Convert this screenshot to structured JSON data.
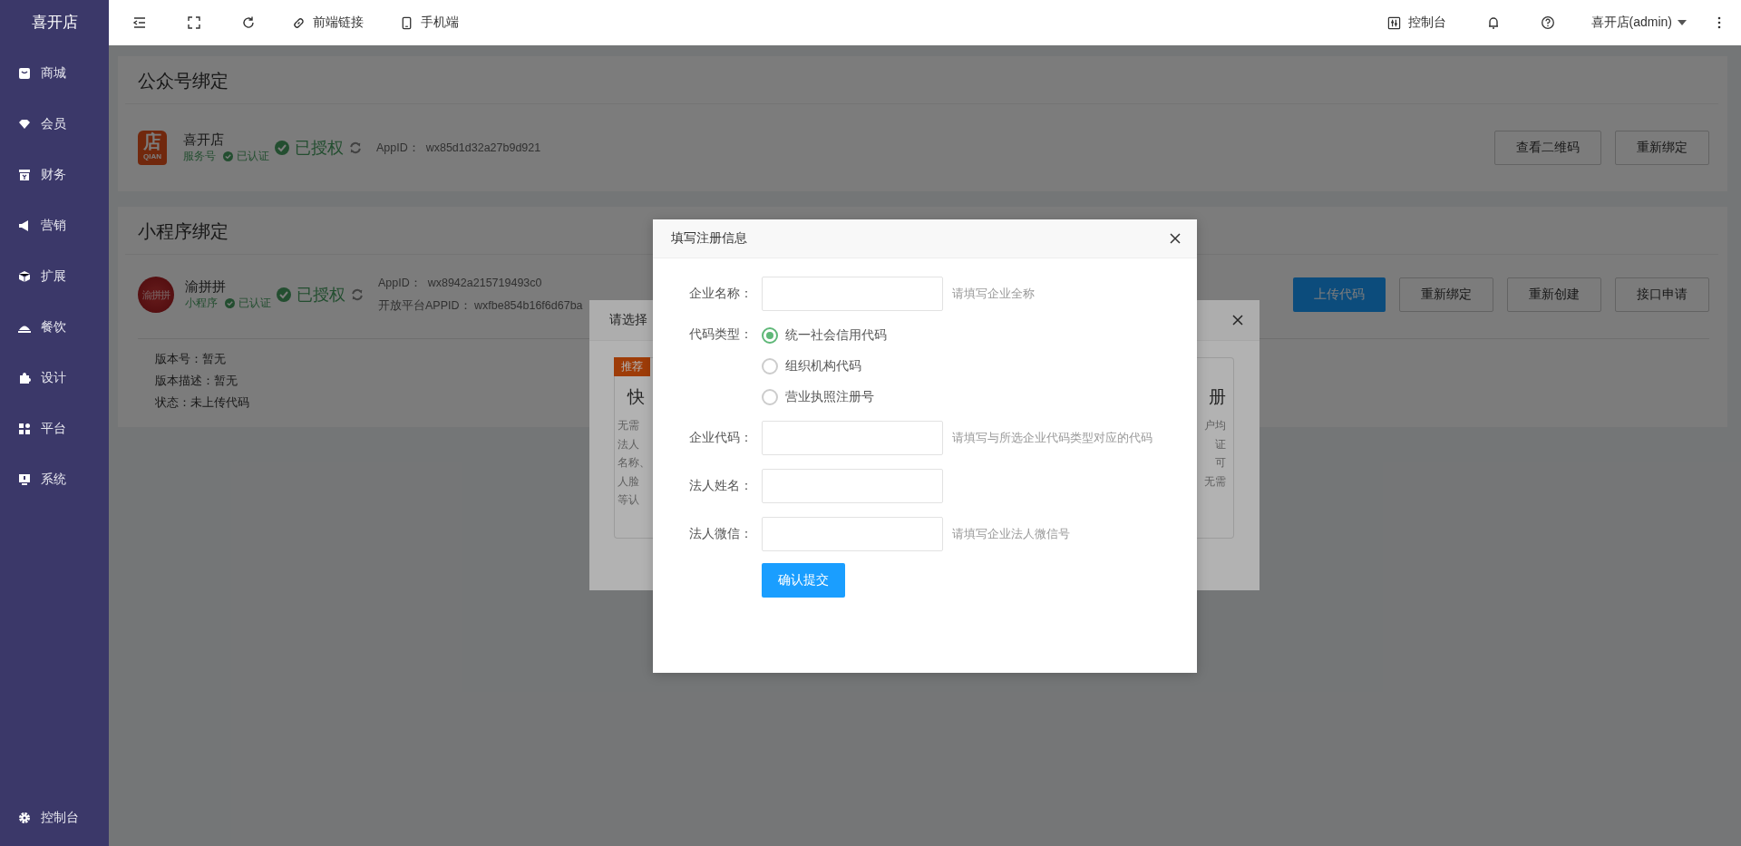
{
  "sidebar": {
    "logo": "喜开店",
    "items": [
      {
        "label": "商城"
      },
      {
        "label": "会员"
      },
      {
        "label": "财务"
      },
      {
        "label": "营销"
      },
      {
        "label": "扩展"
      },
      {
        "label": "餐饮"
      },
      {
        "label": "设计"
      },
      {
        "label": "平台"
      },
      {
        "label": "系统"
      }
    ],
    "footer": {
      "label": "控制台"
    }
  },
  "topbar": {
    "links": [
      "前端链接",
      "手机端"
    ],
    "console": "控制台",
    "user": "喜开店(admin)"
  },
  "official_account": {
    "title": "公众号绑定",
    "logo_text": "店",
    "logo_subtext": "QIAN",
    "name": "喜开店",
    "type": "服务号",
    "verified": "已认证",
    "auth": "已授权",
    "appid_label": "AppID：",
    "appid": "wx85d1d32a27b9d921",
    "buttons": [
      {
        "label": "查看二维码",
        "kind": "default"
      },
      {
        "label": "重新绑定",
        "kind": "default"
      }
    ]
  },
  "mini_program": {
    "title": "小程序绑定",
    "avatar_text": "渝拼拼",
    "name": "渝拼拼",
    "type": "小程序",
    "verified": "已认证",
    "auth": "已授权",
    "appid_label": "AppID：",
    "appid": "wx8942a215719493c0",
    "open_appid_label": "开放平台APPID：",
    "open_appid": "wxfbe854b16f6d67ba",
    "buttons": [
      {
        "label": "上传代码",
        "kind": "primary"
      },
      {
        "label": "重新绑定",
        "kind": "default"
      },
      {
        "label": "重新创建",
        "kind": "default"
      },
      {
        "label": "接口申请",
        "kind": "default"
      }
    ],
    "info": [
      {
        "label": "版本号：",
        "value": "暂无"
      },
      {
        "label": "版本描述：",
        "value": "暂无"
      },
      {
        "label": "状态：",
        "value": "未上传代码"
      }
    ]
  },
  "choose_modal": {
    "title": "请选择",
    "left_card": {
      "badge": "推荐",
      "title": "快",
      "lines": [
        "无需",
        "法人",
        "名称、",
        "人脸",
        "等认"
      ]
    },
    "right_card": {
      "title": "册",
      "lines": [
        "户均",
        "证",
        "可",
        "无需"
      ]
    }
  },
  "register_modal": {
    "title": "填写注册信息",
    "fields": [
      {
        "kind": "text",
        "label": "企业名称：",
        "hint": "请填写企业全称"
      },
      {
        "kind": "radio",
        "label": "代码类型：",
        "options": [
          {
            "label": "统一社会信用代码",
            "selected": true
          },
          {
            "label": "组织机构代码",
            "selected": false
          },
          {
            "label": "营业执照注册号",
            "selected": false
          }
        ]
      },
      {
        "kind": "text",
        "label": "企业代码：",
        "hint": "请填写与所选企业代码类型对应的代码"
      },
      {
        "kind": "text",
        "label": "法人姓名："
      },
      {
        "kind": "text",
        "label": "法人微信：",
        "hint": "请填写企业法人微信号"
      }
    ],
    "submit": "确认提交"
  }
}
